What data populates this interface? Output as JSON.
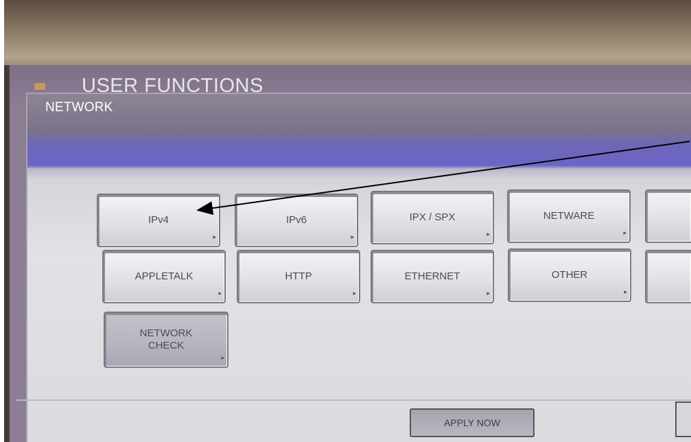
{
  "screen": {
    "app_title": "USER FUNCTIONS",
    "panel_title": "NETWORK"
  },
  "buttons": {
    "row1": [
      "IPv4",
      "IPv6",
      "IPX / SPX",
      "NETWARE"
    ],
    "row2": [
      "APPLETALK",
      "HTTP",
      "ETHERNET",
      "OTHER"
    ],
    "row3": [
      "NETWORK\nCHECK"
    ]
  },
  "footer": {
    "apply_label": "APPLY NOW"
  },
  "colors": {
    "header_band": "#6a65c9",
    "panel_bg": "#e3e1e5"
  }
}
